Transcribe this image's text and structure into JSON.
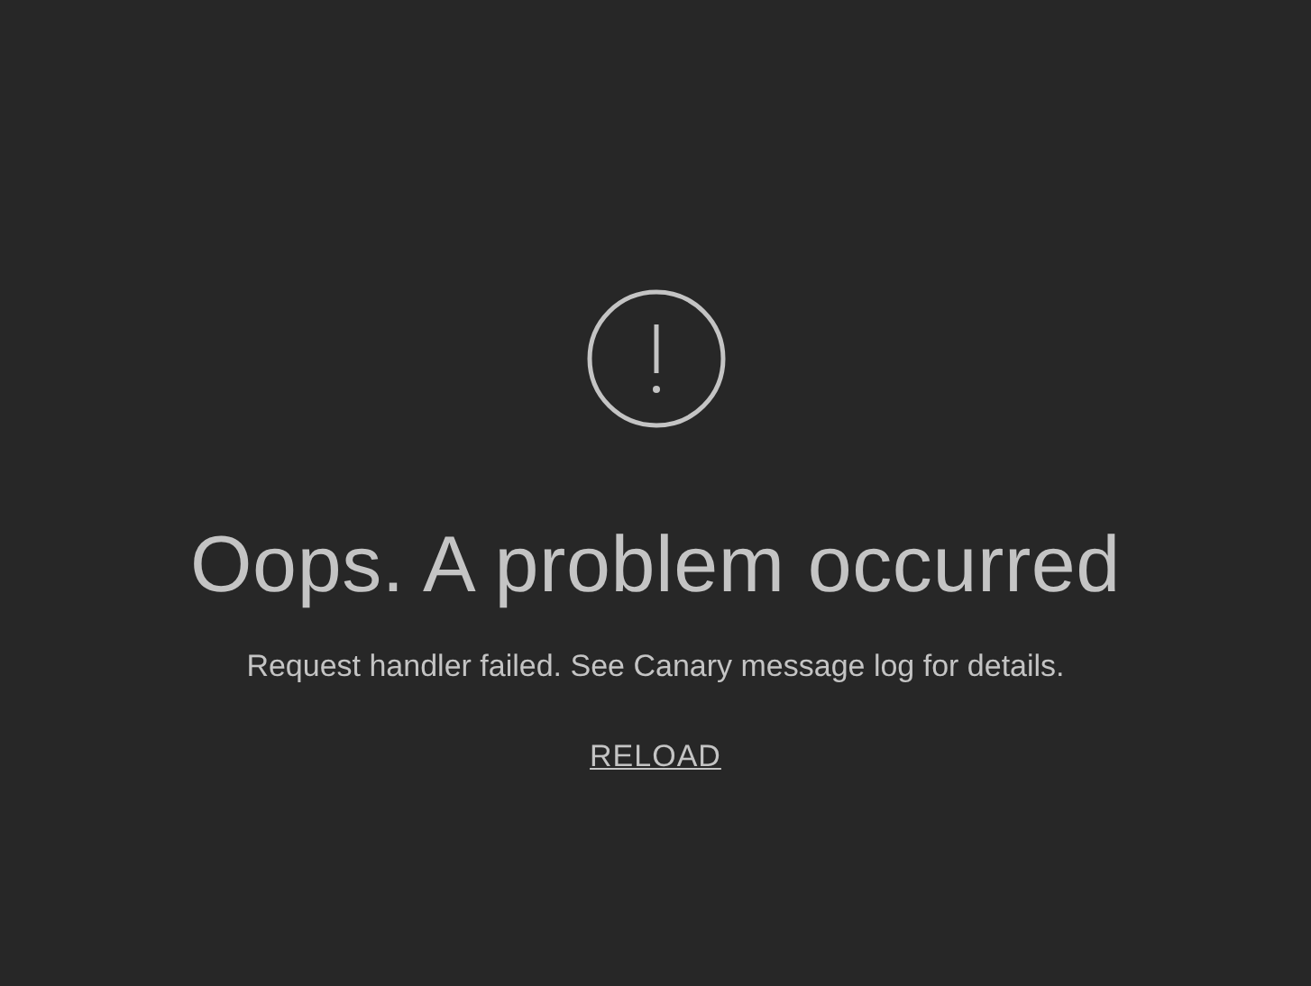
{
  "error": {
    "title": "Oops. A problem occurred",
    "message": "Request handler failed. See Canary message log for details.",
    "action": "RELOAD"
  }
}
